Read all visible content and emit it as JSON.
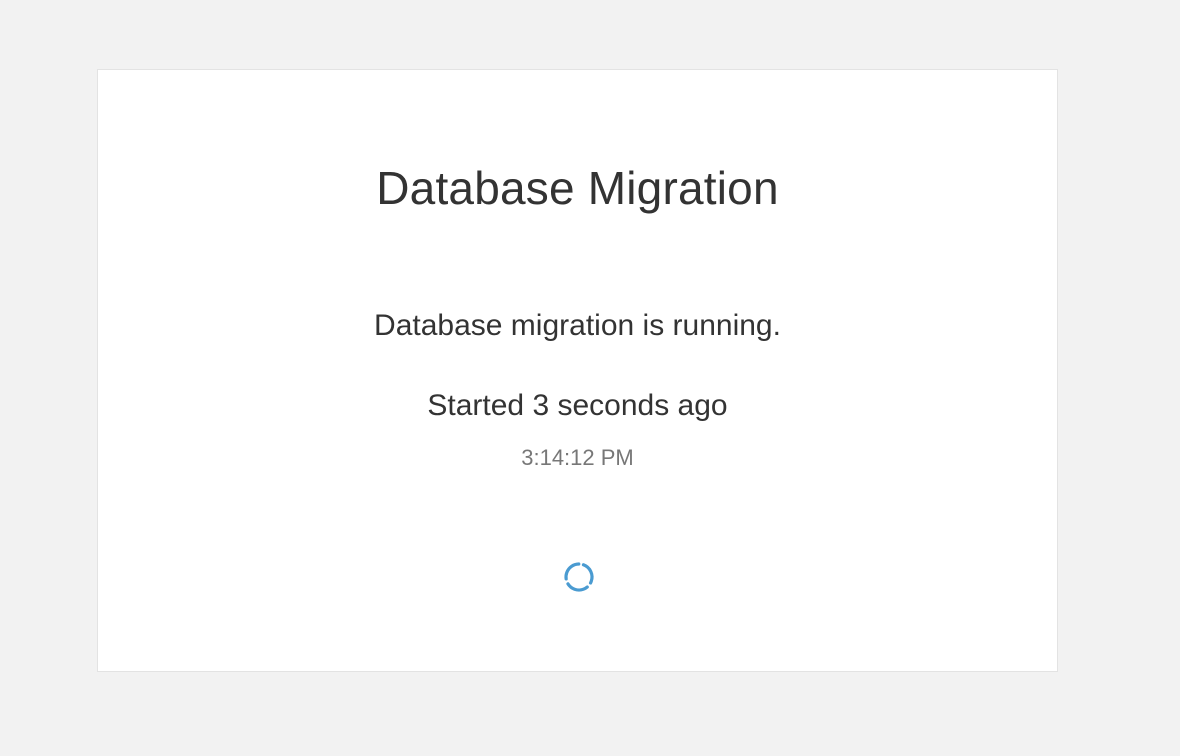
{
  "page": {
    "title": "Database Migration",
    "status_message": "Database migration is running.",
    "started_text": "Started 3 seconds ago",
    "started_time": "3:14:12 PM"
  },
  "colors": {
    "page_background": "#f2f2f2",
    "card_background": "#ffffff",
    "spinner": "#4a9bd1"
  },
  "icons": {
    "spinner": "loading-spinner-icon"
  }
}
